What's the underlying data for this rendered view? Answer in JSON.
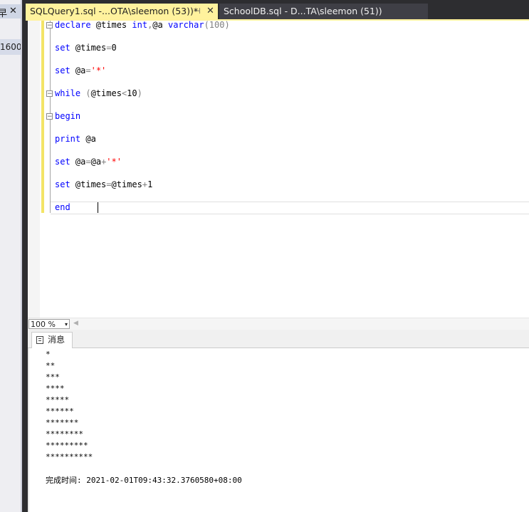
{
  "left_dock": {
    "header_glyph": "早",
    "close_glyph": "✕",
    "value": "1600"
  },
  "tabs": [
    {
      "label": "SQLQuery1.sql -...OTA\\sleemon (53))*",
      "pin": "⊣",
      "close": "✕",
      "active": true
    },
    {
      "label": "SchoolDB.sql - D...TA\\sleemon (51))",
      "active": false
    }
  ],
  "editor": {
    "lines": [
      [
        {
          "t": "declare",
          "c": "kw"
        },
        {
          "t": " @times ",
          "c": ""
        },
        {
          "t": "int",
          "c": "kw"
        },
        {
          "t": ",",
          "c": "gr"
        },
        {
          "t": "@a ",
          "c": ""
        },
        {
          "t": "varchar",
          "c": "kw"
        },
        {
          "t": "(100)",
          "c": "gr"
        }
      ],
      [
        {
          "t": "set",
          "c": "kw"
        },
        {
          "t": " @times",
          "c": ""
        },
        {
          "t": "=",
          "c": "gr"
        },
        {
          "t": "0",
          "c": ""
        }
      ],
      [
        {
          "t": "set",
          "c": "kw"
        },
        {
          "t": " @a",
          "c": ""
        },
        {
          "t": "=",
          "c": "gr"
        },
        {
          "t": "'*'",
          "c": "str"
        }
      ],
      [
        {
          "t": "while",
          "c": "kw"
        },
        {
          "t": " (",
          "c": "gr"
        },
        {
          "t": "@times",
          "c": ""
        },
        {
          "t": "<",
          "c": "gr"
        },
        {
          "t": "10",
          "c": ""
        },
        {
          "t": ")",
          "c": "gr"
        }
      ],
      [
        {
          "t": "begin",
          "c": "kw"
        }
      ],
      [
        {
          "t": "print",
          "c": "kw"
        },
        {
          "t": " @a",
          "c": ""
        }
      ],
      [
        {
          "t": "set",
          "c": "kw"
        },
        {
          "t": " @a",
          "c": ""
        },
        {
          "t": "=",
          "c": "gr"
        },
        {
          "t": "@a",
          "c": ""
        },
        {
          "t": "+",
          "c": "gr"
        },
        {
          "t": "'*'",
          "c": "str"
        }
      ],
      [
        {
          "t": "set",
          "c": "kw"
        },
        {
          "t": " @times",
          "c": ""
        },
        {
          "t": "=",
          "c": "gr"
        },
        {
          "t": "@times",
          "c": ""
        },
        {
          "t": "+",
          "c": "gr"
        },
        {
          "t": "1",
          "c": ""
        }
      ],
      [
        {
          "t": "end",
          "c": "kw"
        }
      ]
    ],
    "fold_markers": "⊟"
  },
  "zoom": {
    "value": "100 %",
    "arrow": "▾",
    "scroll_arrow": "◀"
  },
  "results": {
    "tab_label": "消息",
    "messages": [
      "*",
      "**",
      "***",
      "****",
      "*****",
      "******",
      "*******",
      "********",
      "*********",
      "**********"
    ],
    "completion": "完成时间: 2021-02-01T09:43:32.3760580+08:00"
  }
}
